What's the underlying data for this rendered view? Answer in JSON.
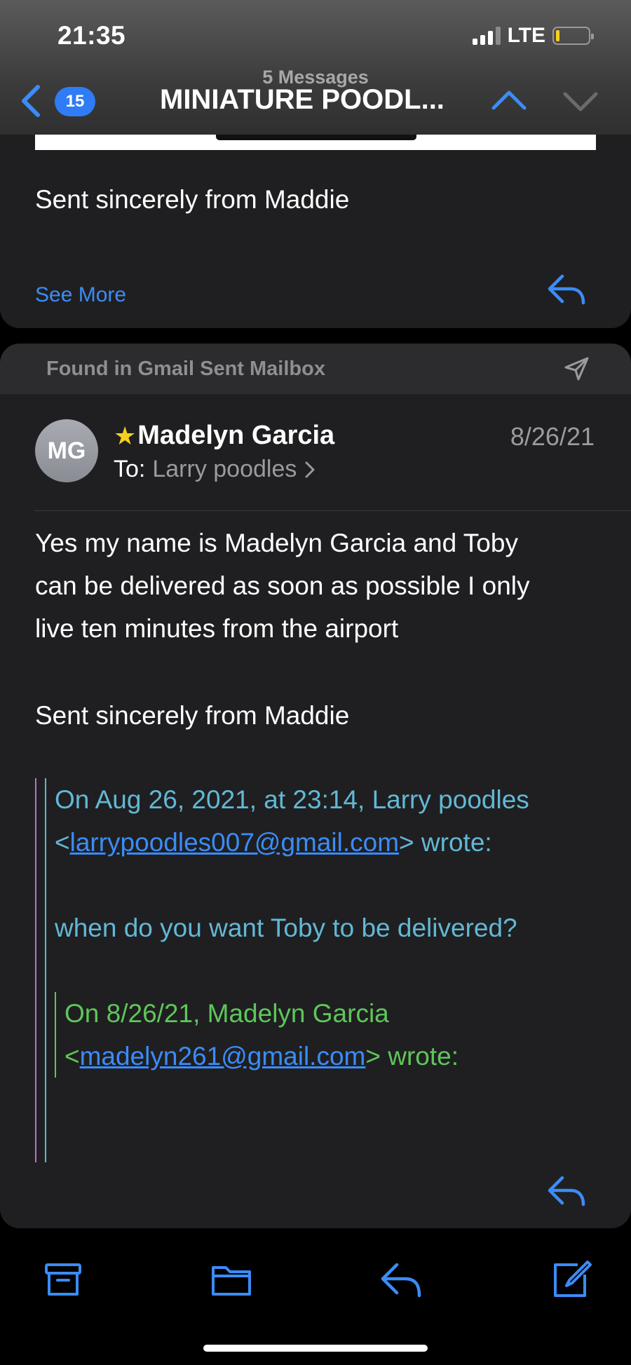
{
  "status_bar": {
    "time": "21:35",
    "network": "LTE"
  },
  "nav": {
    "back_count": "15",
    "subtitle": "5 Messages",
    "title": "MINIATURE POODL..."
  },
  "previous_message": {
    "signature": "Sent sincerely from Maddie",
    "see_more_label": "See More"
  },
  "mailbox_banner": {
    "text": "Found in Gmail Sent Mailbox"
  },
  "message": {
    "avatar_initials": "MG",
    "sender": "Madelyn Garcia",
    "date": "8/26/21",
    "to_label": "To:",
    "to_name": "Larry poodles",
    "body_lines": [
      "Yes my name is Madelyn Garcia and Toby",
      "can be delivered as soon as possible I only",
      "live ten minutes from the airport"
    ],
    "signature": "Sent sincerely from Maddie",
    "quote": {
      "header_line1": "On Aug 26, 2021, at 23:14, Larry poodles",
      "header_open": "<",
      "email": "larrypoodles007@gmail.com",
      "header_close": "> wrote:",
      "text": "when do you want Toby to be delivered?",
      "nested": {
        "header_line1": "On 8/26/21, Madelyn Garcia",
        "header_open": "<",
        "email": "madelyn261@gmail.com",
        "header_close": "> wrote:"
      }
    }
  },
  "colors": {
    "accent": "#2f7cf6",
    "card_bg": "#1f1f21",
    "quote_blue": "#62b8d6",
    "quote_green": "#5fc65a",
    "star": "#f5cf1f",
    "battery": "#f5d020"
  },
  "icons": {
    "toolbar": [
      "archive-icon",
      "folder-icon",
      "reply-icon",
      "compose-icon"
    ]
  }
}
